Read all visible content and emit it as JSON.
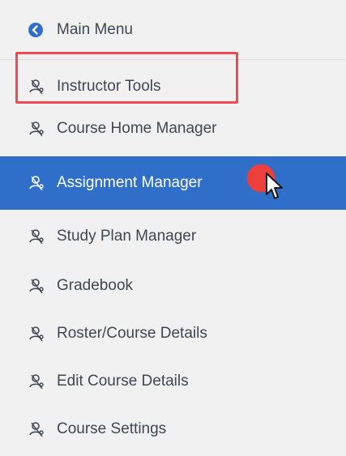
{
  "menu": {
    "main_menu": "Main Menu",
    "items": [
      {
        "label": "Instructor Tools",
        "icon": "user-gear-icon"
      },
      {
        "label": "Course Home Manager",
        "icon": "user-gear-icon"
      },
      {
        "label": "Assignment Manager",
        "icon": "user-gear-icon",
        "active": true
      },
      {
        "label": "Study Plan Manager",
        "icon": "user-gear-icon"
      },
      {
        "label": "Gradebook",
        "icon": "user-gear-icon"
      },
      {
        "label": "Roster/Course Details",
        "icon": "user-gear-icon"
      },
      {
        "label": "Edit Course Details",
        "icon": "user-gear-icon"
      },
      {
        "label": "Course Settings",
        "icon": "user-gear-icon"
      }
    ]
  },
  "colors": {
    "active_bg": "#2f6fc9",
    "highlight_border": "#f14b52",
    "cursor_dot": "#ef3f3d",
    "text": "#3f4752"
  }
}
